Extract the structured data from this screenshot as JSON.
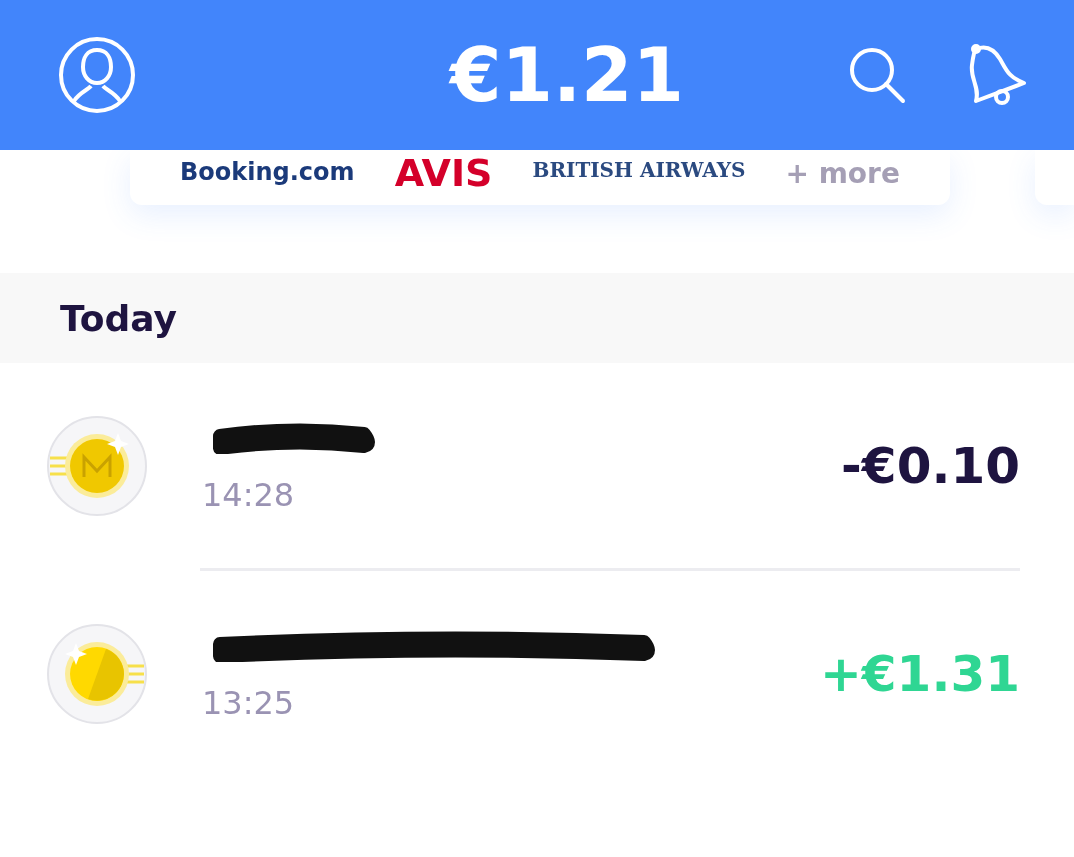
{
  "header": {
    "balance": "€1.21"
  },
  "partners": [
    "Booking.com",
    "AVIS",
    "BRITISH AIRWAYS",
    "+ more"
  ],
  "section": {
    "title": "Today"
  },
  "transactions": [
    {
      "kind": "outgoing",
      "time": "14:28",
      "amount": "-€0.10"
    },
    {
      "kind": "incoming",
      "time": "13:25",
      "amount": "+€1.31"
    }
  ]
}
